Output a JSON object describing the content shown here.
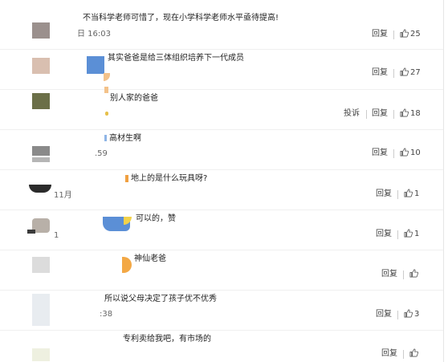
{
  "comments": [
    {
      "text": "不当科学老师可惜了，现在小学科学老师水平亟待提高!",
      "time": "日 16:03",
      "reply": "回复",
      "likes": "25",
      "avatar_color": "#9b908d"
    },
    {
      "text": "其实爸爸是给三体组织培养下一代成员",
      "time": "",
      "reply": "回复",
      "likes": "27",
      "avatar_color": "#d9bfb0"
    },
    {
      "text": "别人家的爸爸",
      "time": "",
      "report": "投诉",
      "reply": "回复",
      "likes": "18",
      "avatar_color": "#6b6f48"
    },
    {
      "text": "高材生啊",
      "time": ".59",
      "reply": "回复",
      "likes": "10",
      "avatar_color": "#8a8a8a"
    },
    {
      "text": "地上的是什么玩具呀?",
      "time": "11月",
      "reply": "回复",
      "likes": "1",
      "avatar_color": "#2b2b2b"
    },
    {
      "text": "可以的，赞",
      "time": "1",
      "reply": "回复",
      "likes": "1",
      "avatar_color": "#b8b0a8"
    },
    {
      "text": "神仙老爸",
      "time": "",
      "reply": "回复",
      "likes": "",
      "avatar_color": "#dcdcdc"
    },
    {
      "text": "所以说父母决定了孩子优不优秀",
      "time": ":38",
      "reply": "回复",
      "likes": "3",
      "avatar_color": "#e8ecf0"
    },
    {
      "text": "专利卖给我吧，有市场的",
      "time": "",
      "reply": "回复",
      "likes": "",
      "avatar_color": "#eef0e0"
    }
  ]
}
